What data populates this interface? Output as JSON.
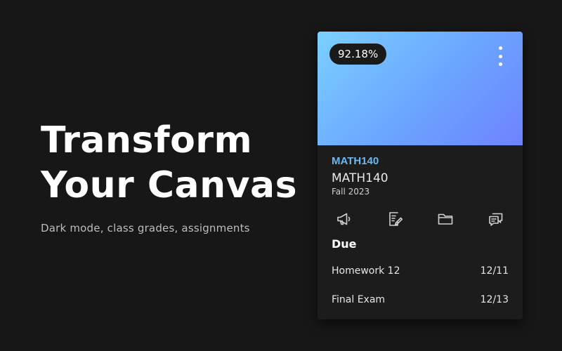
{
  "hero": {
    "title_line1": "Transform",
    "title_line2": "Your Canvas",
    "subtitle": "Dark mode, class grades, assignments"
  },
  "card": {
    "grade": "92.18%",
    "gradient_colors": [
      "#7bd0ff",
      "#6f82ff"
    ],
    "course_code": "MATH140",
    "course_name": "MATH140",
    "term": "Fall 2023",
    "accent_color": "#6cb8ee",
    "icons": [
      "announcements-icon",
      "assignments-icon",
      "files-icon",
      "discussions-icon"
    ],
    "due_heading": "Due",
    "due_items": [
      {
        "name": "Homework 12",
        "date": "12/11"
      },
      {
        "name": "Final Exam",
        "date": "12/13"
      }
    ]
  }
}
